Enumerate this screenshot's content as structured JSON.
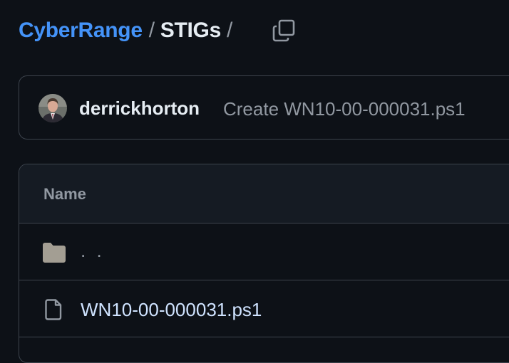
{
  "breadcrumb": {
    "repo": "CyberRange",
    "separator": "/",
    "folder": "STIGs",
    "trailing_separator": "/"
  },
  "icons": {
    "copy": "copy-icon",
    "folder": "folder-icon",
    "file": "file-icon"
  },
  "latest_commit": {
    "author": "derrickhorton",
    "message": "Create WN10-00-000031.ps1"
  },
  "file_table": {
    "header_name": "Name",
    "rows": [
      {
        "type": "folder",
        "name": ". ."
      },
      {
        "type": "file",
        "name": "WN10-00-000031.ps1"
      }
    ]
  },
  "colors": {
    "background": "#0d1117",
    "link": "#4493f8",
    "border": "#3d444d",
    "muted": "#9198a1",
    "folder_icon": "#a39e93"
  }
}
